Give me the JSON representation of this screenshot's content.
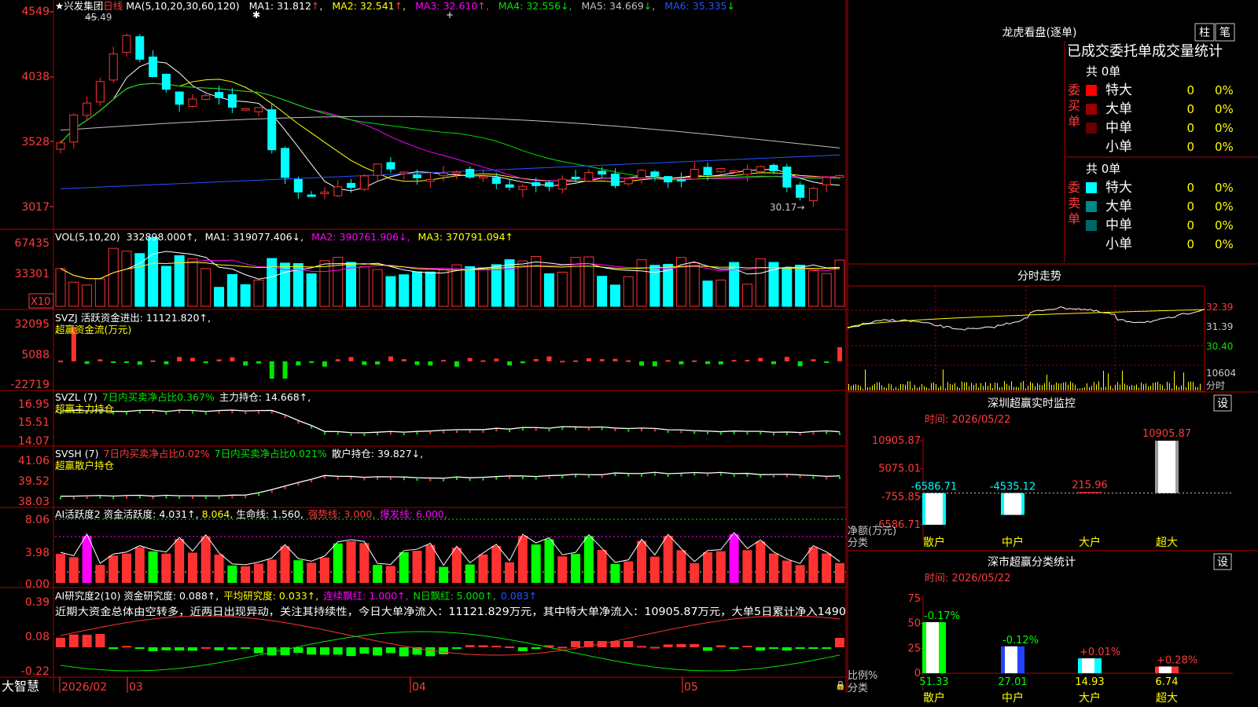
{
  "stock": {
    "name": "兴发集团",
    "period": "日线",
    "star": "★"
  },
  "price_pane": {
    "ma_spec": "MA(5,10,20,30,60,120)",
    "ma_values": [
      {
        "label": "MA1:",
        "value": "31.812",
        "arrow": "↑",
        "color": "#ffffff"
      },
      {
        "label": "MA2:",
        "value": "32.541",
        "arrow": "↑",
        "color": "#ffff00"
      },
      {
        "label": "MA3:",
        "value": "32.610",
        "arrow": "↑",
        "color": "#ff00ff"
      },
      {
        "label": "MA4:",
        "value": "32.556",
        "arrow": "↓",
        "color": "#00e600"
      },
      {
        "label": "MA5:",
        "value": "34.669",
        "arrow": "↓",
        "color": "#c0c0c0"
      },
      {
        "label": "MA6:",
        "value": "35.335",
        "arrow": "↓",
        "color": "#2255ff"
      }
    ],
    "yticks": [
      "4549",
      "4038",
      "3528",
      "3017"
    ],
    "high_label": "45.49",
    "low_label": "30.17"
  },
  "vol_pane": {
    "spec": "VOL(5,10,20)",
    "value": "332898.000↑,",
    "mas": [
      {
        "text": "MA1: 319077.406↓,",
        "color": "#ffffff"
      },
      {
        "text": "MA2: 390761.906↓,",
        "color": "#ff00ff"
      },
      {
        "text": "MA3: 370791.094↑",
        "color": "#ffff00"
      }
    ],
    "yticks": [
      "67435",
      "33301"
    ],
    "unit": "X10"
  },
  "svzj_pane": {
    "line1": "SVZJ  活跃资金进出: 11121.820↑,",
    "line2": "超赢资金流(万元)",
    "yticks": [
      "32095",
      "5088",
      "-22719"
    ]
  },
  "svzl_pane": {
    "spec": "SVZL (7)",
    "t1": "7日内买卖净占比0.367%",
    "t2": "主力持仓: 14.668↑,",
    "line2": "超赢主力持仓",
    "yticks": [
      "16.95",
      "15.51",
      "14.07"
    ]
  },
  "svsh_pane": {
    "spec": "SVSH (7)",
    "t1": "7日内买卖净占比0.02%",
    "t2": "7日内买卖净占比0.021%",
    "t3": "散户持仓: 39.827↓,",
    "line2": "超赢散户持仓",
    "yticks": [
      "41.06",
      "39.52",
      "38.03"
    ]
  },
  "ai_active_pane": {
    "t1": "AI活跃度2 资金活跃度: 4.031↑,",
    "t2": "8.064,",
    "t3": "生命线: 1.560,",
    "t4": "强势线: 3.000,",
    "t5": "爆发线: 6.000,",
    "yticks": [
      "8.06",
      "3.98",
      "0.00"
    ]
  },
  "ai_research_pane": {
    "t1": "AI研究度2(10) 资金研究度: 0.088↑,",
    "t2": "平均研究度: 0.033↑,",
    "t3": "连续飘红: 1.000↑,",
    "t4": "N日飘红: 5.000↑,",
    "t5": "0.083↑",
    "summary": "近期大资金总体由空转多，近两日出现异动，关注其持续性，今日大单净流入：11121.829万元，其中特大单净流入：10905.87万元，大单5日累计净入1490",
    "yticks": [
      "0.39",
      "0.08",
      "-0.22"
    ]
  },
  "date_axis": {
    "brand": "大智慧",
    "labels": [
      "2026/02",
      "03",
      "04",
      "05"
    ]
  },
  "lhkp": {
    "title": "龙虎看盘(逐单)",
    "btn1": "柱",
    "btn2": "笔",
    "subtitle": "已成交委托单成交量统计",
    "buy": {
      "side": "委买单",
      "total": "共 0单",
      "rows": [
        {
          "label": "特大",
          "count": "0",
          "pct": "0%",
          "color": "#ff0000"
        },
        {
          "label": "大单",
          "count": "0",
          "pct": "0%",
          "color": "#990000"
        },
        {
          "label": "中单",
          "count": "0",
          "pct": "0%",
          "color": "#660000"
        },
        {
          "label": "小单",
          "count": "0",
          "pct": "0%",
          "color": "#000000"
        }
      ]
    },
    "sell": {
      "side": "委卖单",
      "total": "共 0单",
      "rows": [
        {
          "label": "特大",
          "count": "0",
          "pct": "0%",
          "color": "#00ffff"
        },
        {
          "label": "大单",
          "count": "0",
          "pct": "0%",
          "color": "#008888"
        },
        {
          "label": "中单",
          "count": "0",
          "pct": "0%",
          "color": "#006666"
        },
        {
          "label": "小单",
          "count": "0",
          "pct": "0%",
          "color": "#000000"
        }
      ]
    }
  },
  "intraday": {
    "title": "分时走势",
    "yticks": [
      "32.39",
      "31.39",
      "30.40"
    ],
    "vol_tick": "10604",
    "xlabel": "分时"
  },
  "monitor": {
    "title": "深圳超赢实时监控",
    "settings": "设",
    "time_label": "时间: 2026/05/22",
    "ylabel": "净额(万元)",
    "xlabel": "分类",
    "yticks": [
      "10905.87",
      "5075.01",
      "-755.85",
      "-6586.71"
    ],
    "chart_data": {
      "type": "bar",
      "categories": [
        "散户",
        "中户",
        "大户",
        "超大"
      ],
      "values": [
        -6586.71,
        -4535.12,
        215.96,
        10905.87
      ],
      "value_labels": [
        "-6586.71",
        "-4535.12",
        "215.96",
        "10905.87"
      ],
      "ylim": [
        -6586.71,
        10905.87
      ]
    }
  },
  "class_stats": {
    "title": "深市超赢分类统计",
    "settings": "设",
    "time_label": "时间: 2026/05/22",
    "ylabel": "比例%",
    "xlabel": "分类",
    "yticks": [
      "75",
      "50",
      "25",
      "0"
    ],
    "chart_data": {
      "type": "bar",
      "categories": [
        "散户",
        "中户",
        "大户",
        "超大"
      ],
      "values": [
        51.33,
        27.01,
        14.93,
        6.74
      ],
      "value_labels": [
        "51.33",
        "27.01",
        "14.93",
        "6.74"
      ],
      "changes": [
        "-0.17%",
        "-0.12%",
        "+0.01%",
        "+0.28%"
      ],
      "ylim": [
        0,
        75
      ]
    }
  }
}
